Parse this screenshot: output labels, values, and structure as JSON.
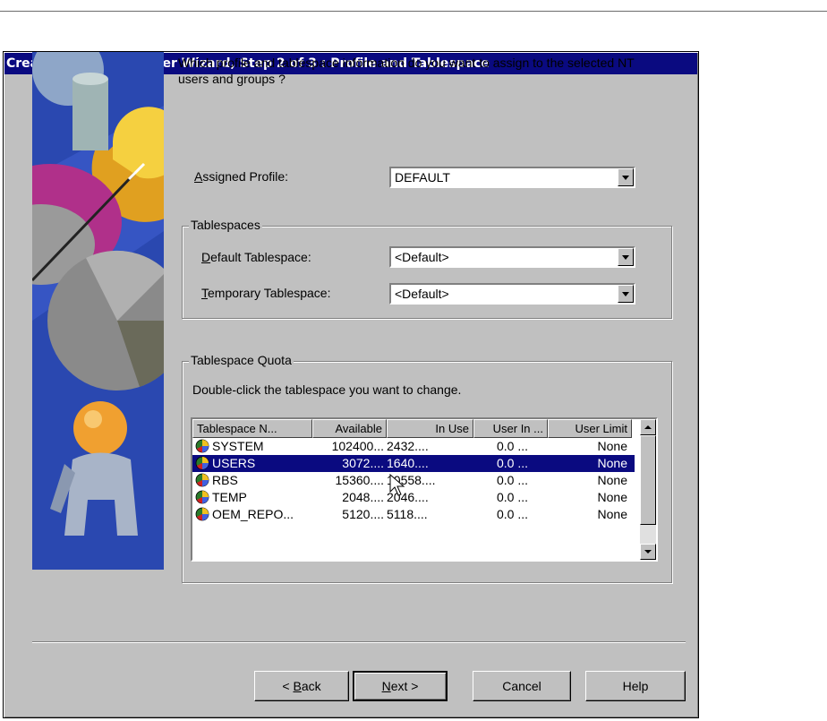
{
  "window": {
    "title": "Create External OS User Wizard, Step 2 of 3 : Profile and Tablespace"
  },
  "prompt": "Which profile and tablespace information do you want to assign to the selected NT users and groups ?",
  "profile": {
    "label_key": "A",
    "label_rest": "ssigned Profile:",
    "value": "DEFAULT"
  },
  "tablespaces": {
    "title": "Tablespaces",
    "default_label_key": "D",
    "default_label_rest": "efault Tablespace:",
    "default_value": "<Default>",
    "temporary_label_key": "T",
    "temporary_label_rest": "emporary Tablespace:",
    "temporary_value": "<Default>"
  },
  "quota": {
    "title": "Tablespace Quota",
    "instruction": "Double-click the tablespace you want to change.",
    "columns": [
      "Tablespace N...",
      "Available",
      "In Use",
      "User In ...",
      "User Limit"
    ],
    "rows": [
      {
        "name": "SYSTEM",
        "available": "102400...",
        "in_use": "2432....",
        "user_in": "0.0 ...",
        "limit": "None",
        "selected": false
      },
      {
        "name": "USERS",
        "available": "3072....",
        "in_use": "1640....",
        "user_in": "0.0 ...",
        "limit": "None",
        "selected": true
      },
      {
        "name": "RBS",
        "available": "15360....",
        "in_use": "10558....",
        "user_in": "0.0 ...",
        "limit": "None",
        "selected": false
      },
      {
        "name": "TEMP",
        "available": "2048....",
        "in_use": "2046....",
        "user_in": "0.0 ...",
        "limit": "None",
        "selected": false
      },
      {
        "name": "OEM_REPO...",
        "available": "5120....",
        "in_use": "5118....",
        "user_in": "0.0 ...",
        "limit": "None",
        "selected": false
      }
    ]
  },
  "buttons": {
    "back_prefix": "< ",
    "back_key": "B",
    "back_rest": "ack",
    "next_key": "N",
    "next_rest": "ext >",
    "cancel": "Cancel",
    "help": "Help"
  },
  "colors": {
    "title_bar": "#0a0a80",
    "dialog_bg": "#c0c0c0",
    "selection": "#0a0a80",
    "art_bg": "#2a48b0"
  }
}
